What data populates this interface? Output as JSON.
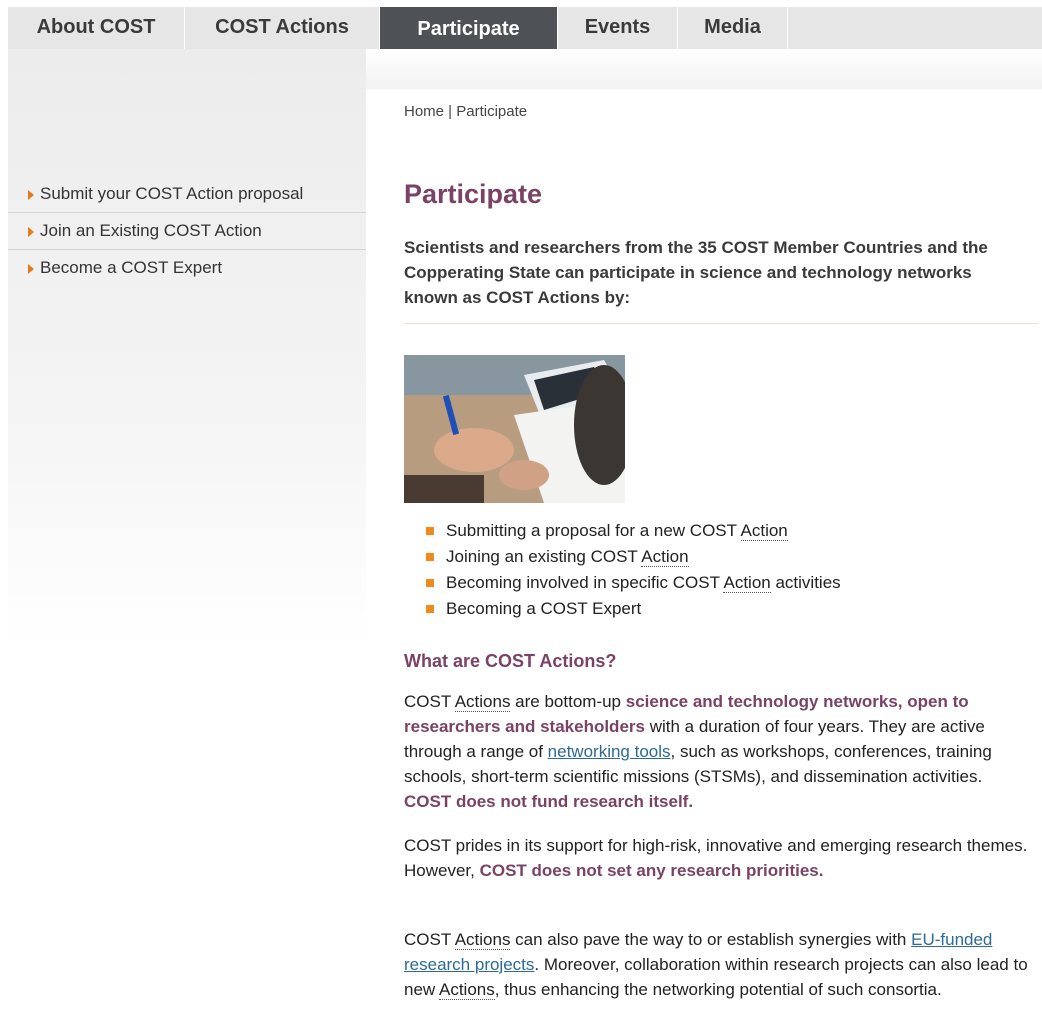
{
  "nav": {
    "tabs": [
      {
        "label": "About COST"
      },
      {
        "label": "COST Actions"
      },
      {
        "label": "Participate",
        "active": true
      },
      {
        "label": "Events"
      },
      {
        "label": "Media"
      }
    ]
  },
  "sidebar": {
    "items": [
      {
        "label": "Submit your COST Action proposal"
      },
      {
        "label": "Join an Existing COST Action"
      },
      {
        "label": "Become a COST Expert"
      }
    ]
  },
  "breadcrumb": {
    "home": "Home",
    "separator": " | ",
    "current": "Participate"
  },
  "page": {
    "title": "Participate",
    "intro": "Scientists and researchers from the 35 COST Member Countries and the Copperating State can participate in science and technology networks known as COST Actions by:",
    "bullets": [
      {
        "text": "Submitting a proposal for a new COST ",
        "abbr": "Action"
      },
      {
        "text": "Joining an existing COST ",
        "abbr": "Action"
      },
      {
        "text": "Becoming involved in specific COST ",
        "abbr": "Action",
        "after": " activities"
      },
      {
        "text": "Becoming a COST Expert"
      }
    ],
    "section_title": "What are COST Actions?",
    "p1": {
      "a": "COST ",
      "b": "Actions",
      "c": " are bottom-up ",
      "d": "science and technology networks, open to researchers and stakeholders",
      "e": " with a duration of four years. They are active through a range of ",
      "f": "networking tools",
      "g": ", such as workshops, conferences, training schools, short-term scientific missions (STSMs), and dissemination activities. ",
      "h": "COST does not fund research itself."
    },
    "p2": {
      "a": "COST prides in its support for high-risk, innovative and emerging research themes. However, ",
      "b": "COST does not set any research priorities."
    },
    "p3": {
      "a": "COST ",
      "b": "Actions",
      "c": " can also pave the way to or establish synergies with ",
      "d": "EU-funded research projects",
      "e": ". Moreover, collaboration within research projects can also lead to new ",
      "f": "Actions",
      "g": ", thus enhancing the networking potential of such consortia."
    }
  },
  "colors": {
    "accent": "#7a4366",
    "bullet": "#f08a1c",
    "link": "#2c6a97",
    "nav_active": "#4e5257"
  }
}
